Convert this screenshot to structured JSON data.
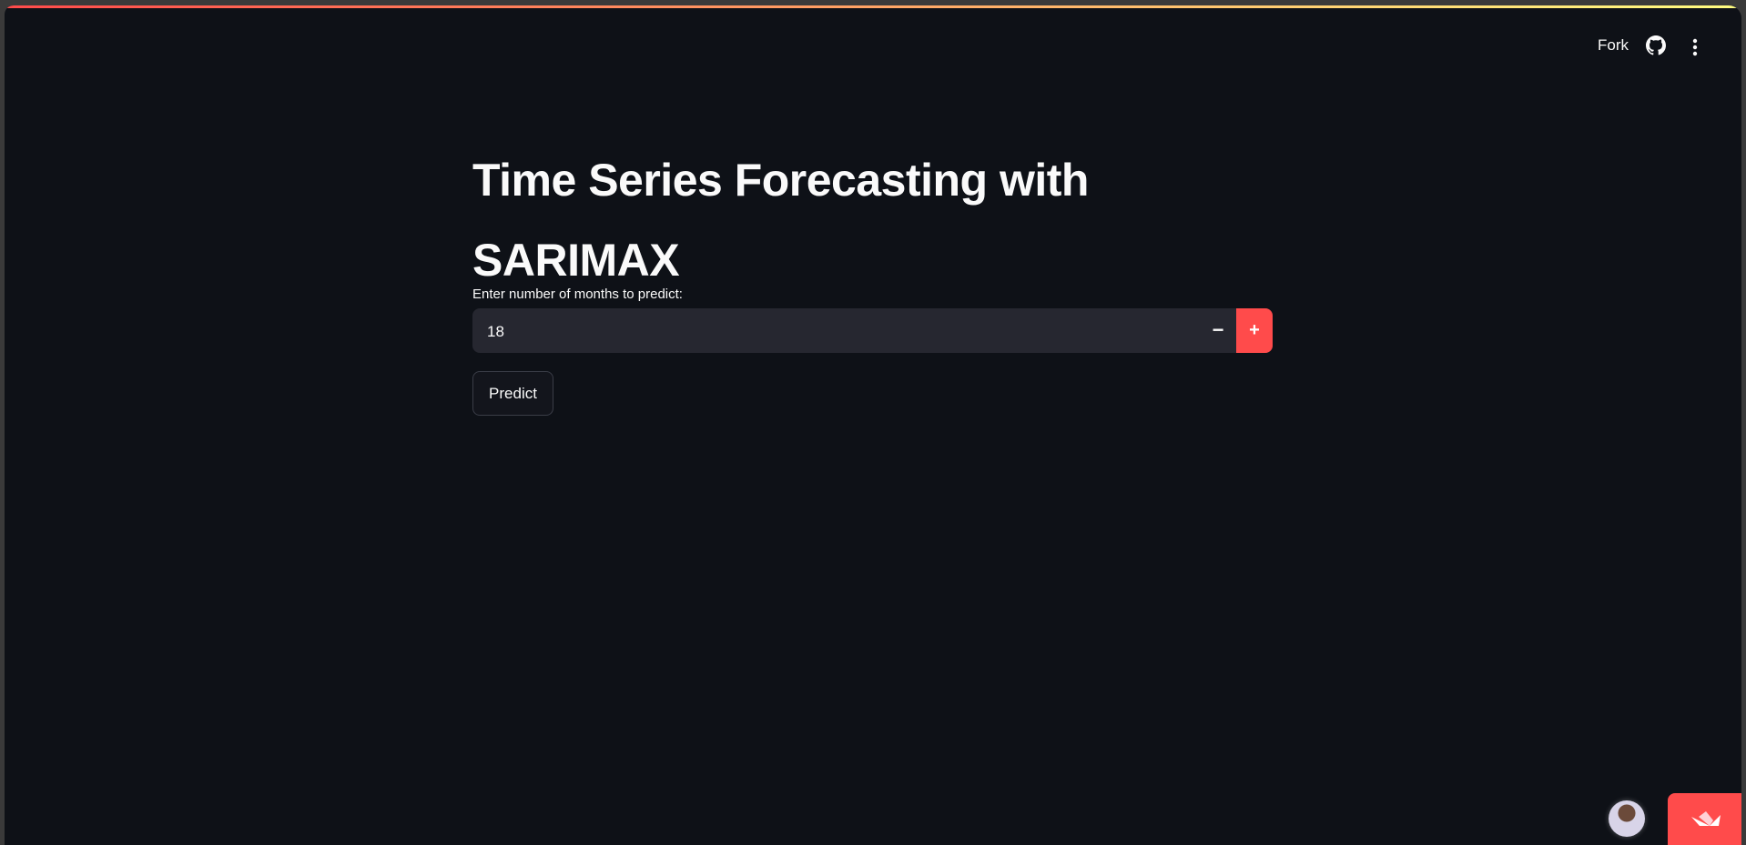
{
  "header": {
    "fork_label": "Fork",
    "github_icon": "github-icon",
    "menu_icon": "kebab-menu-icon"
  },
  "main": {
    "title": "Time Series Forecasting with SARIMAX",
    "input_label": "Enter number of months to predict:",
    "input_value": "18",
    "minus_label": "−",
    "plus_label": "+",
    "predict_label": "Predict"
  },
  "colors": {
    "accent": "#ff4b4b",
    "background": "#0e1117",
    "input_bg": "#262730"
  }
}
